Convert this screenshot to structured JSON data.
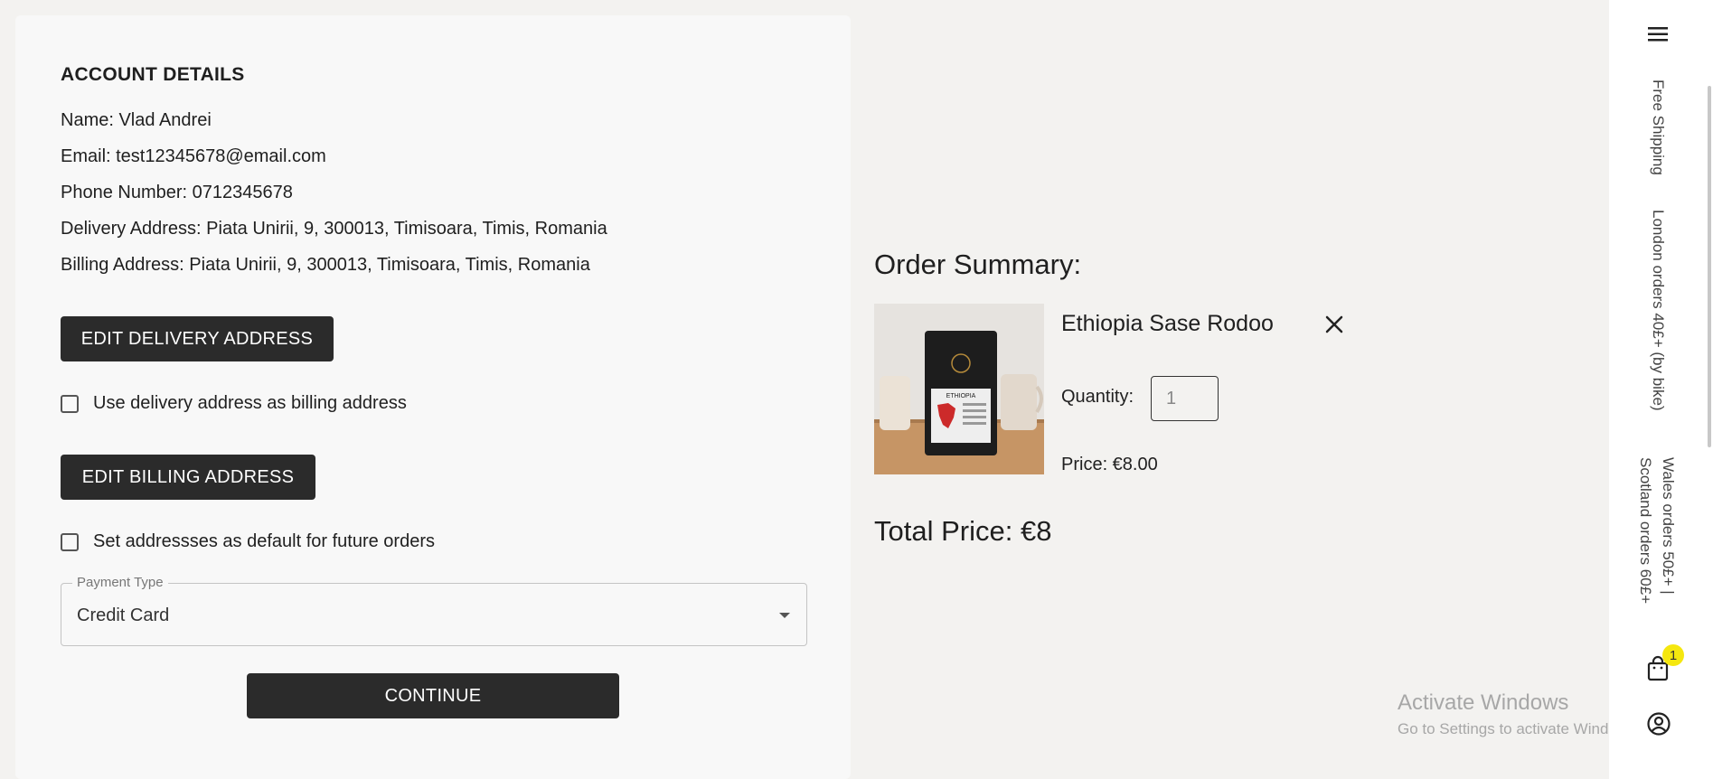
{
  "account": {
    "title": "ACCOUNT DETAILS",
    "name": "Name: Vlad Andrei",
    "email": "Email: test12345678@email.com",
    "phone": "Phone Number: 0712345678",
    "delivery": "Delivery Address: Piata Unirii, 9, 300013, Timisoara, Timis, Romania",
    "billing": "Billing Address: Piata Unirii, 9, 300013, Timisoara, Timis, Romania",
    "edit_delivery_label": "EDIT DELIVERY ADDRESS",
    "use_delivery_label": "Use delivery address as billing address",
    "edit_billing_label": "EDIT BILLING ADDRESS",
    "set_default_label": "Set addressses as default for future orders",
    "payment": {
      "legend": "Payment Type",
      "value": "Credit Card"
    },
    "continue_label": "CONTINUE"
  },
  "summary": {
    "title": "Order Summary:",
    "item": {
      "name": "Ethiopia Sase Rodoo",
      "package_text": "ETHIOPIA",
      "quantity_label": "Quantity:",
      "quantity": "1",
      "price": "Price: €8.00"
    },
    "total": "Total Price: €8"
  },
  "sidebar": {
    "banner1": "Free Shipping",
    "banner2": "London orders 40£+ (by bike)",
    "banner3": "Wales orders 50£+ |",
    "banner4": "Scotland orders 60£+",
    "cart_count": "1"
  },
  "watermark": {
    "title": "Activate Windows",
    "subtitle": "Go to Settings to activate Windows."
  },
  "colors": {
    "dark_button": "#2b2b2b",
    "badge": "#f5e70f",
    "page_bg": "#f3f2f0",
    "panel_bg": "#f8f8f8"
  }
}
